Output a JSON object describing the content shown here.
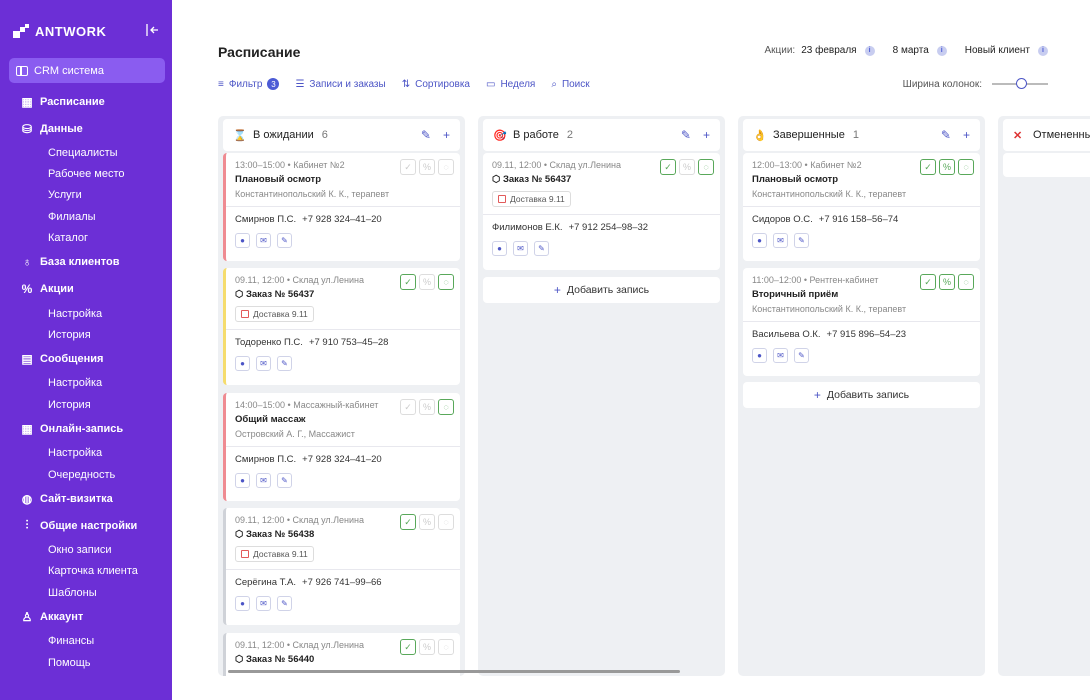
{
  "brand": {
    "name": "ANTWORK"
  },
  "sidebar": {
    "crm_label": "CRM система",
    "groups": [
      {
        "label": "Расписание",
        "icon": "calendar-icon",
        "items": []
      },
      {
        "label": "Данные",
        "icon": "database-icon",
        "items": [
          "Специалисты",
          "Рабочее место",
          "Услуги",
          "Филиалы",
          "Каталог"
        ]
      },
      {
        "label": "База клиентов",
        "icon": "users-icon",
        "items": []
      },
      {
        "label": "Акции",
        "icon": "percent-icon",
        "items": [
          "Настройка",
          "История"
        ]
      },
      {
        "label": "Сообщения",
        "icon": "messages-icon",
        "items": [
          "Настройка",
          "История"
        ]
      },
      {
        "label": "Онлайн-запись",
        "icon": "calendar-icon",
        "items": [
          "Настройка",
          "Очередность"
        ]
      },
      {
        "label": "Сайт-визитка",
        "icon": "globe-icon",
        "items": []
      },
      {
        "label": "Общие настройки",
        "icon": "sliders-icon",
        "items": [
          "Окно записи",
          "Карточка клиента",
          "Шаблоны"
        ]
      },
      {
        "label": "Аккаунт",
        "icon": "user-icon",
        "items": [
          "Финансы",
          "Помощь"
        ]
      }
    ]
  },
  "header": {
    "title": "Расписание",
    "promo_label": "Акции:",
    "promo1": "23 февраля",
    "promo2": "8 марта",
    "promo3": "Новый клиент"
  },
  "toolbar": {
    "filter": "Фильтр",
    "filter_count": "3",
    "records": "Записи и заказы",
    "sort": "Сортировка",
    "week": "Неделя",
    "search": "Поиск",
    "col_width": "Ширина колонок:"
  },
  "columns": [
    {
      "title": "В ожидании",
      "count": "6",
      "emoji": "⌛"
    },
    {
      "title": "В работе",
      "count": "2",
      "emoji": "🎯"
    },
    {
      "title": "Завершенные",
      "count": "1",
      "emoji": "👌"
    },
    {
      "title": "Отмененные",
      "count": "",
      "emoji": "✕"
    }
  ],
  "cards": {
    "c1": {
      "time": "13:00–15:00 • Кабинет №2",
      "name": "Плановый осмотр",
      "doc": "Константинопольский К. К., терапевт",
      "client": "Смирнов П.С.",
      "phone": "+7 928 324–41–20"
    },
    "c2": {
      "time": "09.11, 12:00 • Склад ул.Ленина",
      "name": "Заказ № 56437",
      "deliv": "Доставка 9.11",
      "client": "Тодоренко П.С.",
      "phone": "+7 910 753–45–28"
    },
    "c3": {
      "time": "14:00–15:00 • Массажный-кабинет",
      "name": "Общий массаж",
      "doc": "Островский А. Г., Массажист",
      "client": "Смирнов П.С.",
      "phone": "+7 928 324–41–20"
    },
    "c4": {
      "time": "09.11, 12:00 • Склад ул.Ленина",
      "name": "Заказ № 56438",
      "deliv": "Доставка 9.11",
      "client": "Серёгина Т.А.",
      "phone": "+7 926 741–99–66"
    },
    "c5": {
      "time": "09.11, 12:00 • Склад ул.Ленина",
      "name": "Заказ № 56440"
    },
    "c6": {
      "time": "09.11, 12:00 • Склад ул.Ленина",
      "name": "Заказ № 56437",
      "deliv": "Доставка 9.11",
      "client": "Филимонов Е.К.",
      "phone": "+7 912 254–98–32"
    },
    "c7": {
      "time": "12:00–13:00 • Кабинет №2",
      "name": "Плановый осмотр",
      "doc": "Константинопольский К. К., терапевт",
      "client": "Сидоров О.С.",
      "phone": "+7 916 158–56–74"
    },
    "c8": {
      "time": "11:00–12:00 • Рентген-кабинет",
      "name": "Вторичный приём",
      "doc": "Константинопольский К. К., терапевт",
      "client": "Васильева О.К.",
      "phone": "+7 915 896–54–23"
    }
  },
  "add_label": "Добавить запись",
  "colors": {
    "sidebar": "#6c2fd6",
    "accent": "#4c55c6",
    "success": "#59a85a"
  }
}
